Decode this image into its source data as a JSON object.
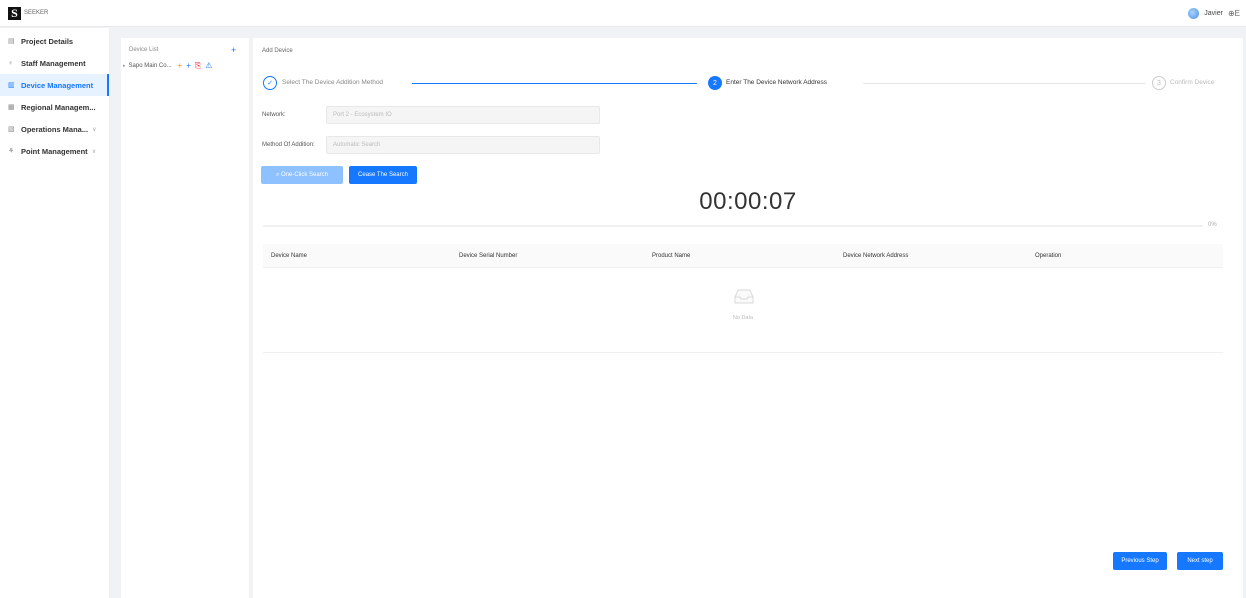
{
  "app": {
    "logo_letter": "S",
    "logo_text": "SEEKER"
  },
  "user": {
    "name": "Javier",
    "lang": "E"
  },
  "nav": [
    {
      "label": "Project Details",
      "icon": "▤"
    },
    {
      "label": "Staff Management",
      "icon": "♀"
    },
    {
      "label": "Device Management",
      "icon": "▥"
    },
    {
      "label": "Regional Managem...",
      "icon": "▦"
    },
    {
      "label": "Operations Mana...",
      "icon": "▧",
      "chevron": "∨"
    },
    {
      "label": "Point Management",
      "icon": "⚘",
      "chevron": "∨"
    }
  ],
  "tree": {
    "header": "Device List",
    "add": "+",
    "root_label": "Sapo Main Co...",
    "actions": [
      "+",
      "+",
      "⎘",
      "⚠"
    ]
  },
  "page": {
    "title": "Add Device"
  },
  "steps": [
    {
      "index": "✓",
      "label": "Select The Device Addition Method"
    },
    {
      "index": "2",
      "label": "Enter The Device Network Address"
    },
    {
      "index": "3",
      "label": "Confirm Device"
    }
  ],
  "form": {
    "network_label": "Network:",
    "network_value": "Port 2 - Ecosystem IO",
    "method_label": "Method Of Addition:",
    "method_value": "Automatic Search"
  },
  "buttons": {
    "one_click": "⌕ One-Click Search",
    "cease": "Cease The Search",
    "prev": "Previous Step",
    "next": "Next step"
  },
  "timer": "00:00:07",
  "progress": {
    "percent": 0,
    "label": "0%"
  },
  "table": {
    "columns": [
      "Device Name",
      "Device Serial Number",
      "Product Name",
      "Device Network Address",
      "Operation"
    ],
    "empty_text": "No Data"
  },
  "colors": {
    "primary": "#1677ff",
    "primary_light": "#8ec1ff"
  }
}
